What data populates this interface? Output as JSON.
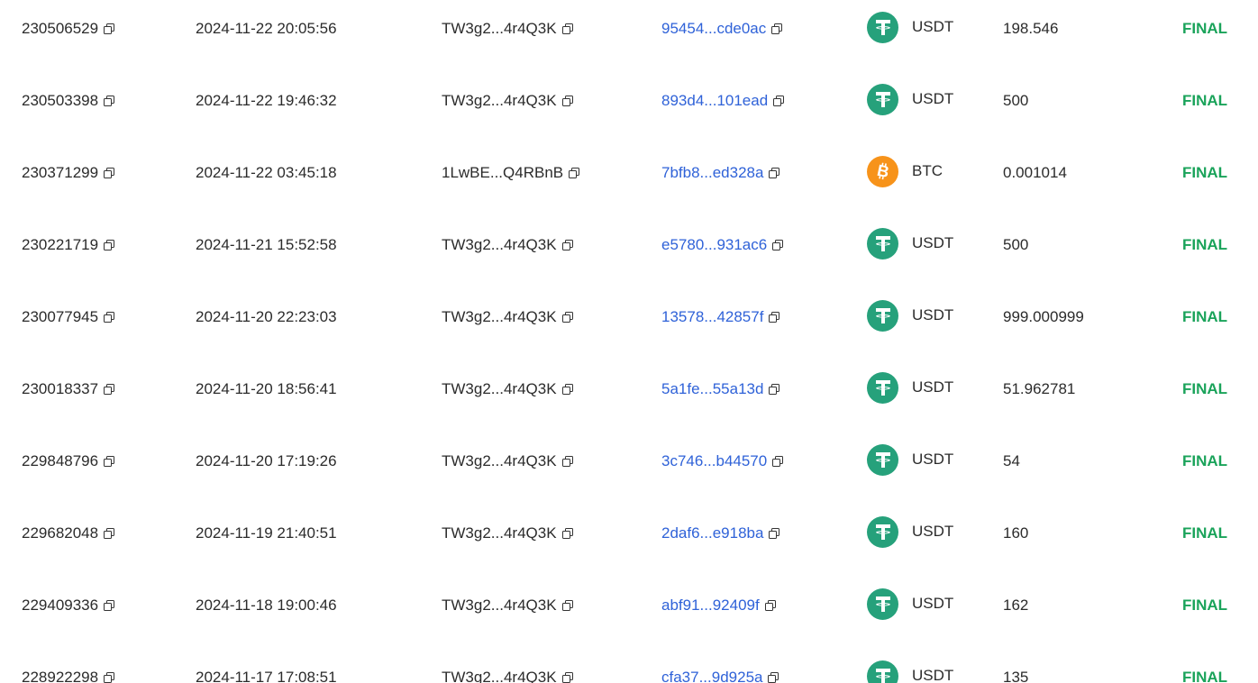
{
  "colors": {
    "link": "#2f62d8",
    "status_final": "#1aa35a",
    "usdt": "#26a17b",
    "btc": "#f7931a",
    "text": "#2b2b2b"
  },
  "rows": [
    {
      "id": "230506529",
      "time": "2024-11-22 20:05:56",
      "address": "TW3g2...4r4Q3K",
      "hash": "95454...cde0ac",
      "coin_icon": "tether-icon",
      "currency": "USDT",
      "amount": "198.546",
      "status": "FINAL"
    },
    {
      "id": "230503398",
      "time": "2024-11-22 19:46:32",
      "address": "TW3g2...4r4Q3K",
      "hash": "893d4...101ead",
      "coin_icon": "tether-icon",
      "currency": "USDT",
      "amount": "500",
      "status": "FINAL"
    },
    {
      "id": "230371299",
      "time": "2024-11-22 03:45:18",
      "address": "1LwBE...Q4RBnB",
      "hash": "7bfb8...ed328a",
      "coin_icon": "bitcoin-icon",
      "currency": "BTC",
      "amount": "0.001014",
      "status": "FINAL"
    },
    {
      "id": "230221719",
      "time": "2024-11-21 15:52:58",
      "address": "TW3g2...4r4Q3K",
      "hash": "e5780...931ac6",
      "coin_icon": "tether-icon",
      "currency": "USDT",
      "amount": "500",
      "status": "FINAL"
    },
    {
      "id": "230077945",
      "time": "2024-11-20 22:23:03",
      "address": "TW3g2...4r4Q3K",
      "hash": "13578...42857f",
      "coin_icon": "tether-icon",
      "currency": "USDT",
      "amount": "999.000999",
      "status": "FINAL"
    },
    {
      "id": "230018337",
      "time": "2024-11-20 18:56:41",
      "address": "TW3g2...4r4Q3K",
      "hash": "5a1fe...55a13d",
      "coin_icon": "tether-icon",
      "currency": "USDT",
      "amount": "51.962781",
      "status": "FINAL"
    },
    {
      "id": "229848796",
      "time": "2024-11-20 17:19:26",
      "address": "TW3g2...4r4Q3K",
      "hash": "3c746...b44570",
      "coin_icon": "tether-icon",
      "currency": "USDT",
      "amount": "54",
      "status": "FINAL"
    },
    {
      "id": "229682048",
      "time": "2024-11-19 21:40:51",
      "address": "TW3g2...4r4Q3K",
      "hash": "2daf6...e918ba",
      "coin_icon": "tether-icon",
      "currency": "USDT",
      "amount": "160",
      "status": "FINAL"
    },
    {
      "id": "229409336",
      "time": "2024-11-18 19:00:46",
      "address": "TW3g2...4r4Q3K",
      "hash": "abf91...92409f",
      "coin_icon": "tether-icon",
      "currency": "USDT",
      "amount": "162",
      "status": "FINAL"
    },
    {
      "id": "228922298",
      "time": "2024-11-17 17:08:51",
      "address": "TW3g2...4r4Q3K",
      "hash": "cfa37...9d925a",
      "coin_icon": "tether-icon",
      "currency": "USDT",
      "amount": "135",
      "status": "FINAL"
    }
  ]
}
